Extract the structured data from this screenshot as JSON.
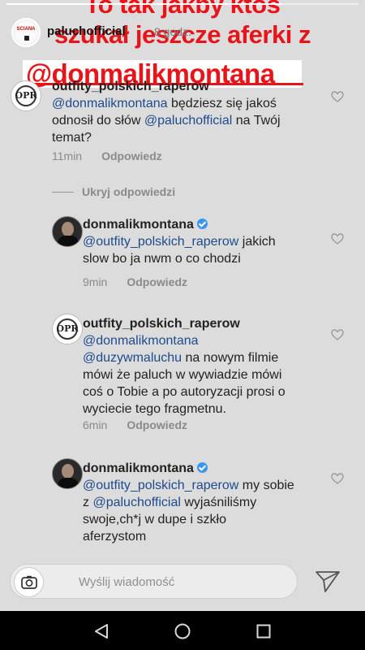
{
  "story": {
    "headline_line1": "To tak jakby ktoś",
    "headline_line2": "szukał jeszcze aferki z",
    "mention_banner": "@donmalikmontana",
    "username": "paluchofficial",
    "time": "8 godz.",
    "avatar_text": "SCIANA",
    "progress": 0.78
  },
  "comments": [
    {
      "username": "outfity_polskich_raperow",
      "verified": false,
      "avatar": "outfity-logo",
      "lines": [
        [
          {
            "t": "@donmalikmontana",
            "m": true
          },
          {
            "t": " będziesz się jakoś",
            "m": false
          }
        ],
        [
          {
            "t": "odnosił do słów ",
            "m": false
          },
          {
            "t": "@paluchofficial",
            "m": true
          },
          {
            "t": " na Twój",
            "m": false
          }
        ],
        [
          {
            "t": "temat?",
            "m": false
          }
        ]
      ],
      "time": "11min",
      "reply": "Odpowiedz"
    },
    {
      "username": "donmalikmontana",
      "verified": true,
      "avatar": "donmalik-photo",
      "lines": [
        [
          {
            "t": "@outfity_polskich_raperow",
            "m": true
          },
          {
            "t": " jakich",
            "m": false
          }
        ],
        [
          {
            "t": "slow bo ja nwm o co chodzi",
            "m": false
          }
        ]
      ],
      "time": "9min",
      "reply": "Odpowiedz"
    },
    {
      "username": "outfity_polskich_raperow",
      "verified": false,
      "avatar": "outfity-logo",
      "lines": [
        [
          {
            "t": "@donmalikmontana",
            "m": true
          }
        ],
        [
          {
            "t": "@duzywmaluchu",
            "m": true
          },
          {
            "t": " na nowym filmie",
            "m": false
          }
        ],
        [
          {
            "t": "mówi że paluch w wywiadzie mówi",
            "m": false
          }
        ],
        [
          {
            "t": "coś o Tobie a po autoryzacji prosi o",
            "m": false
          }
        ],
        [
          {
            "t": "wyciecie tego fragmetnu.",
            "m": false
          }
        ]
      ],
      "time": "6min",
      "reply": "Odpowiedz"
    },
    {
      "username": "donmalikmontana",
      "verified": true,
      "avatar": "donmalik-photo",
      "lines": [
        [
          {
            "t": "@outfity_polskich_raperow",
            "m": true
          },
          {
            "t": " my sobie",
            "m": false
          }
        ],
        [
          {
            "t": "z ",
            "m": false
          },
          {
            "t": "@paluchofficial",
            "m": true
          },
          {
            "t": " wyjaśniliśmy",
            "m": false
          }
        ],
        [
          {
            "t": "swoje,ch*j w dupe i szkło",
            "m": false
          }
        ],
        [
          {
            "t": "aferzystom",
            "m": false
          }
        ]
      ],
      "time": "",
      "reply": ""
    }
  ],
  "hide_replies_label": "Ukryj odpowiedzi",
  "input": {
    "placeholder": "Wyślij wiadomość"
  },
  "icons": {
    "camera": "camera-icon",
    "send": "send-icon",
    "heart": "heart-icon",
    "verified": "verified-badge-icon",
    "back": "back-icon",
    "home": "home-icon",
    "recent": "recent-apps-icon"
  },
  "colors": {
    "headline": "#e8141a",
    "mention": "#1e4b8c",
    "verified": "#3897f0",
    "meta": "#8a8a8a"
  }
}
